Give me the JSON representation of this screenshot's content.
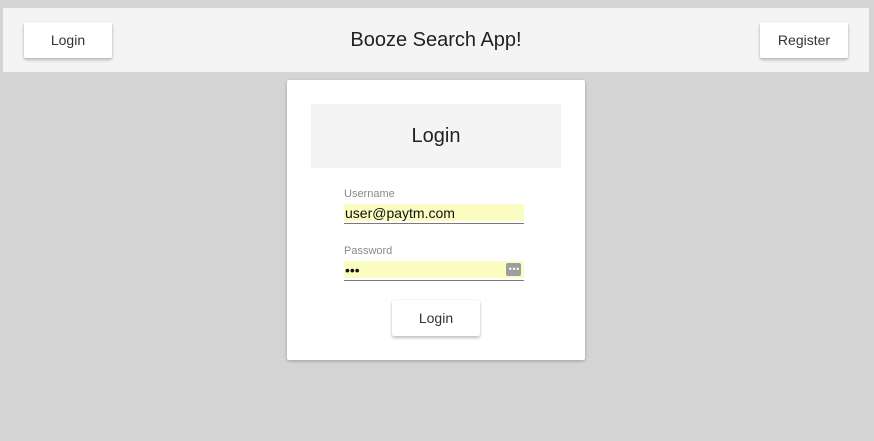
{
  "header": {
    "title": "Booze Search App!",
    "login_label": "Login",
    "register_label": "Register"
  },
  "login_card": {
    "title": "Login",
    "username": {
      "label": "Username",
      "value": "user@paytm.com"
    },
    "password": {
      "label": "Password",
      "value": "abc",
      "autofill_icon": "password-manager-key-icon"
    },
    "submit_label": "Login"
  },
  "colors": {
    "page_background": "#d4d4d4",
    "header_background": "#f4f4f4",
    "card_background": "#ffffff",
    "autofill_background": "#fbfcc0"
  }
}
